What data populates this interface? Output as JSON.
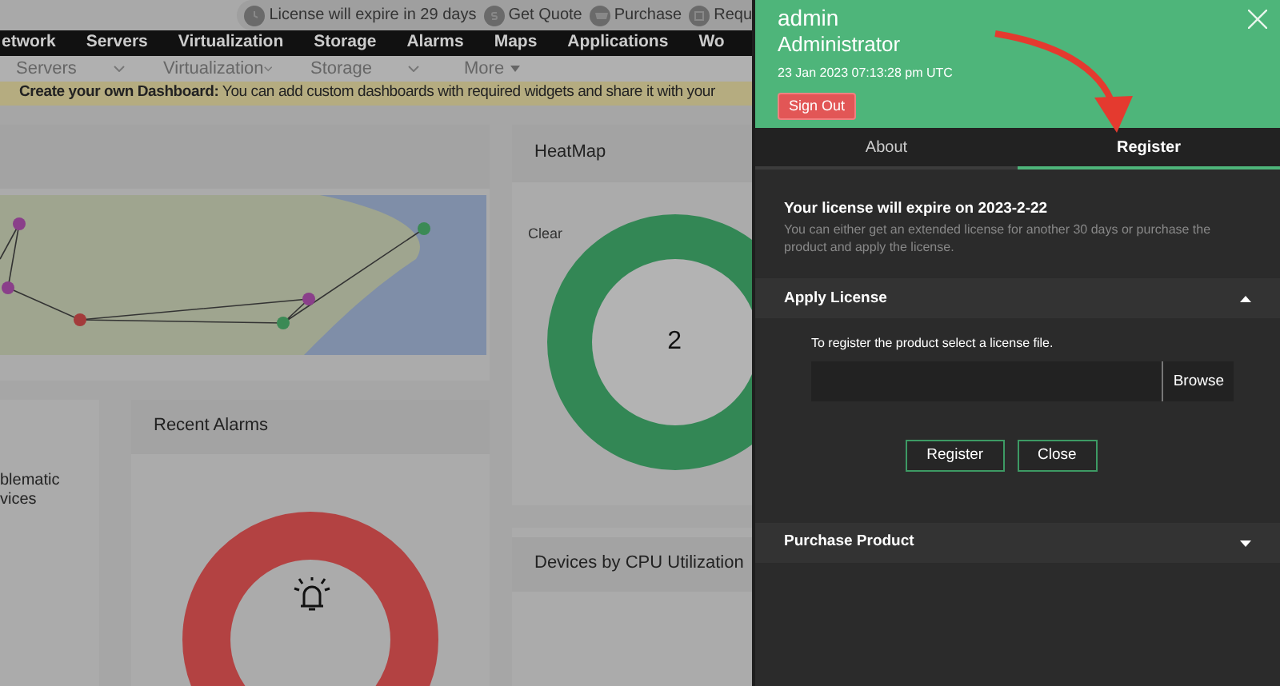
{
  "top_bar": {
    "links": [
      {
        "kind": "clock",
        "label": "License will expire in 29 days"
      },
      {
        "kind": "dollar",
        "label": "Get Quote"
      },
      {
        "kind": "cart",
        "label": "Purchase"
      },
      {
        "kind": "doc",
        "label": "Requ"
      }
    ]
  },
  "nav": {
    "items": [
      "etwork",
      "Servers",
      "Virtualization",
      "Storage",
      "Alarms",
      "Maps",
      "Applications",
      "Wo"
    ]
  },
  "subnav": {
    "items": [
      {
        "label": "Servers",
        "kind": "dropdown"
      },
      {
        "label": "Virtualization",
        "kind": "dropdown"
      },
      {
        "label": "Storage",
        "kind": "dropdown"
      },
      {
        "label": "More",
        "kind": "menu"
      }
    ]
  },
  "banner": {
    "text": "**Create your own Dashboard:** You can add custom dashboards with required widgets and share it with your"
  },
  "widgets": {
    "heatmap": {
      "title": "HeatMap",
      "legend": "Clear",
      "value": "2"
    },
    "problematic": {
      "lines": [
        "blematic",
        "vices"
      ]
    },
    "recent_alarms": {
      "title": "Recent Alarms"
    },
    "cpu": {
      "title": "Devices by CPU Utilization"
    }
  },
  "panel": {
    "user": "admin",
    "role": "Administrator",
    "timestamp": "23 Jan 2023 07:13:28 pm UTC",
    "sign_out": "Sign Out",
    "tabs": [
      {
        "label": "About",
        "selected": false
      },
      {
        "label": "Register",
        "selected": true
      }
    ],
    "license_title": "Your license will expire on 2023-2-22",
    "license_text": "You can either get an extended license for another 30 days or purchase the product and apply the license.",
    "sections": [
      {
        "title": "Apply License",
        "expanded": true
      },
      {
        "title": "Purchase Product",
        "expanded": false
      }
    ],
    "apply": {
      "hint": "To register the product select a license file.",
      "browse": "Browse",
      "buttons": [
        "Register",
        "Close"
      ]
    }
  }
}
